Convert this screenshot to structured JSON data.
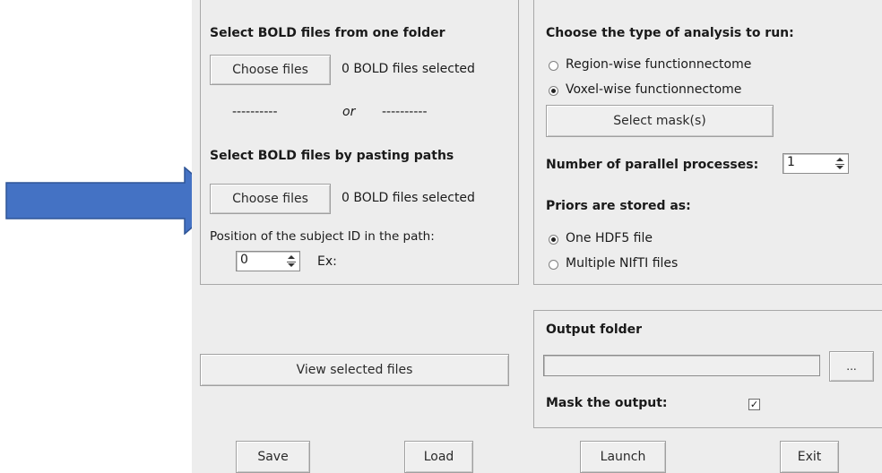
{
  "left_panel": {
    "folder_title": "Select BOLD files from one folder",
    "choose_files_label": "Choose files",
    "folder_count": "0 BOLD files selected",
    "divider_left": "----------",
    "divider_or": "or",
    "divider_right": "----------",
    "paste_title": "Select BOLD files by pasting paths",
    "paste_count": "0 BOLD files selected",
    "position_label": "Position of the subject ID in the path:",
    "position_value": "0",
    "example_label": "Ex:",
    "view_selected": "View selected files"
  },
  "right_panel": {
    "analysis_title": "Choose the type of analysis to run:",
    "region_option": "Region-wise functionnectome",
    "voxel_option": "Voxel-wise functionnectome",
    "analysis_selected": "voxel",
    "select_mask": "Select mask(s)",
    "parallel_label": "Number of parallel processes:",
    "parallel_value": "1",
    "priors_title": "Priors are stored as:",
    "hdf5_option": "One HDF5 file",
    "nifti_option": "Multiple NIfTI files",
    "priors_selected": "hdf5",
    "output_title": "Output folder",
    "output_path": "",
    "browse_label": "...",
    "mask_output_label": "Mask the output:",
    "mask_output_checked": "✓"
  },
  "footer": {
    "save": "Save",
    "load": "Load",
    "launch": "Launch",
    "exit": "Exit"
  },
  "annotation": {
    "arrow_color": "#4472c4",
    "arrow_border": "#2f5597"
  }
}
